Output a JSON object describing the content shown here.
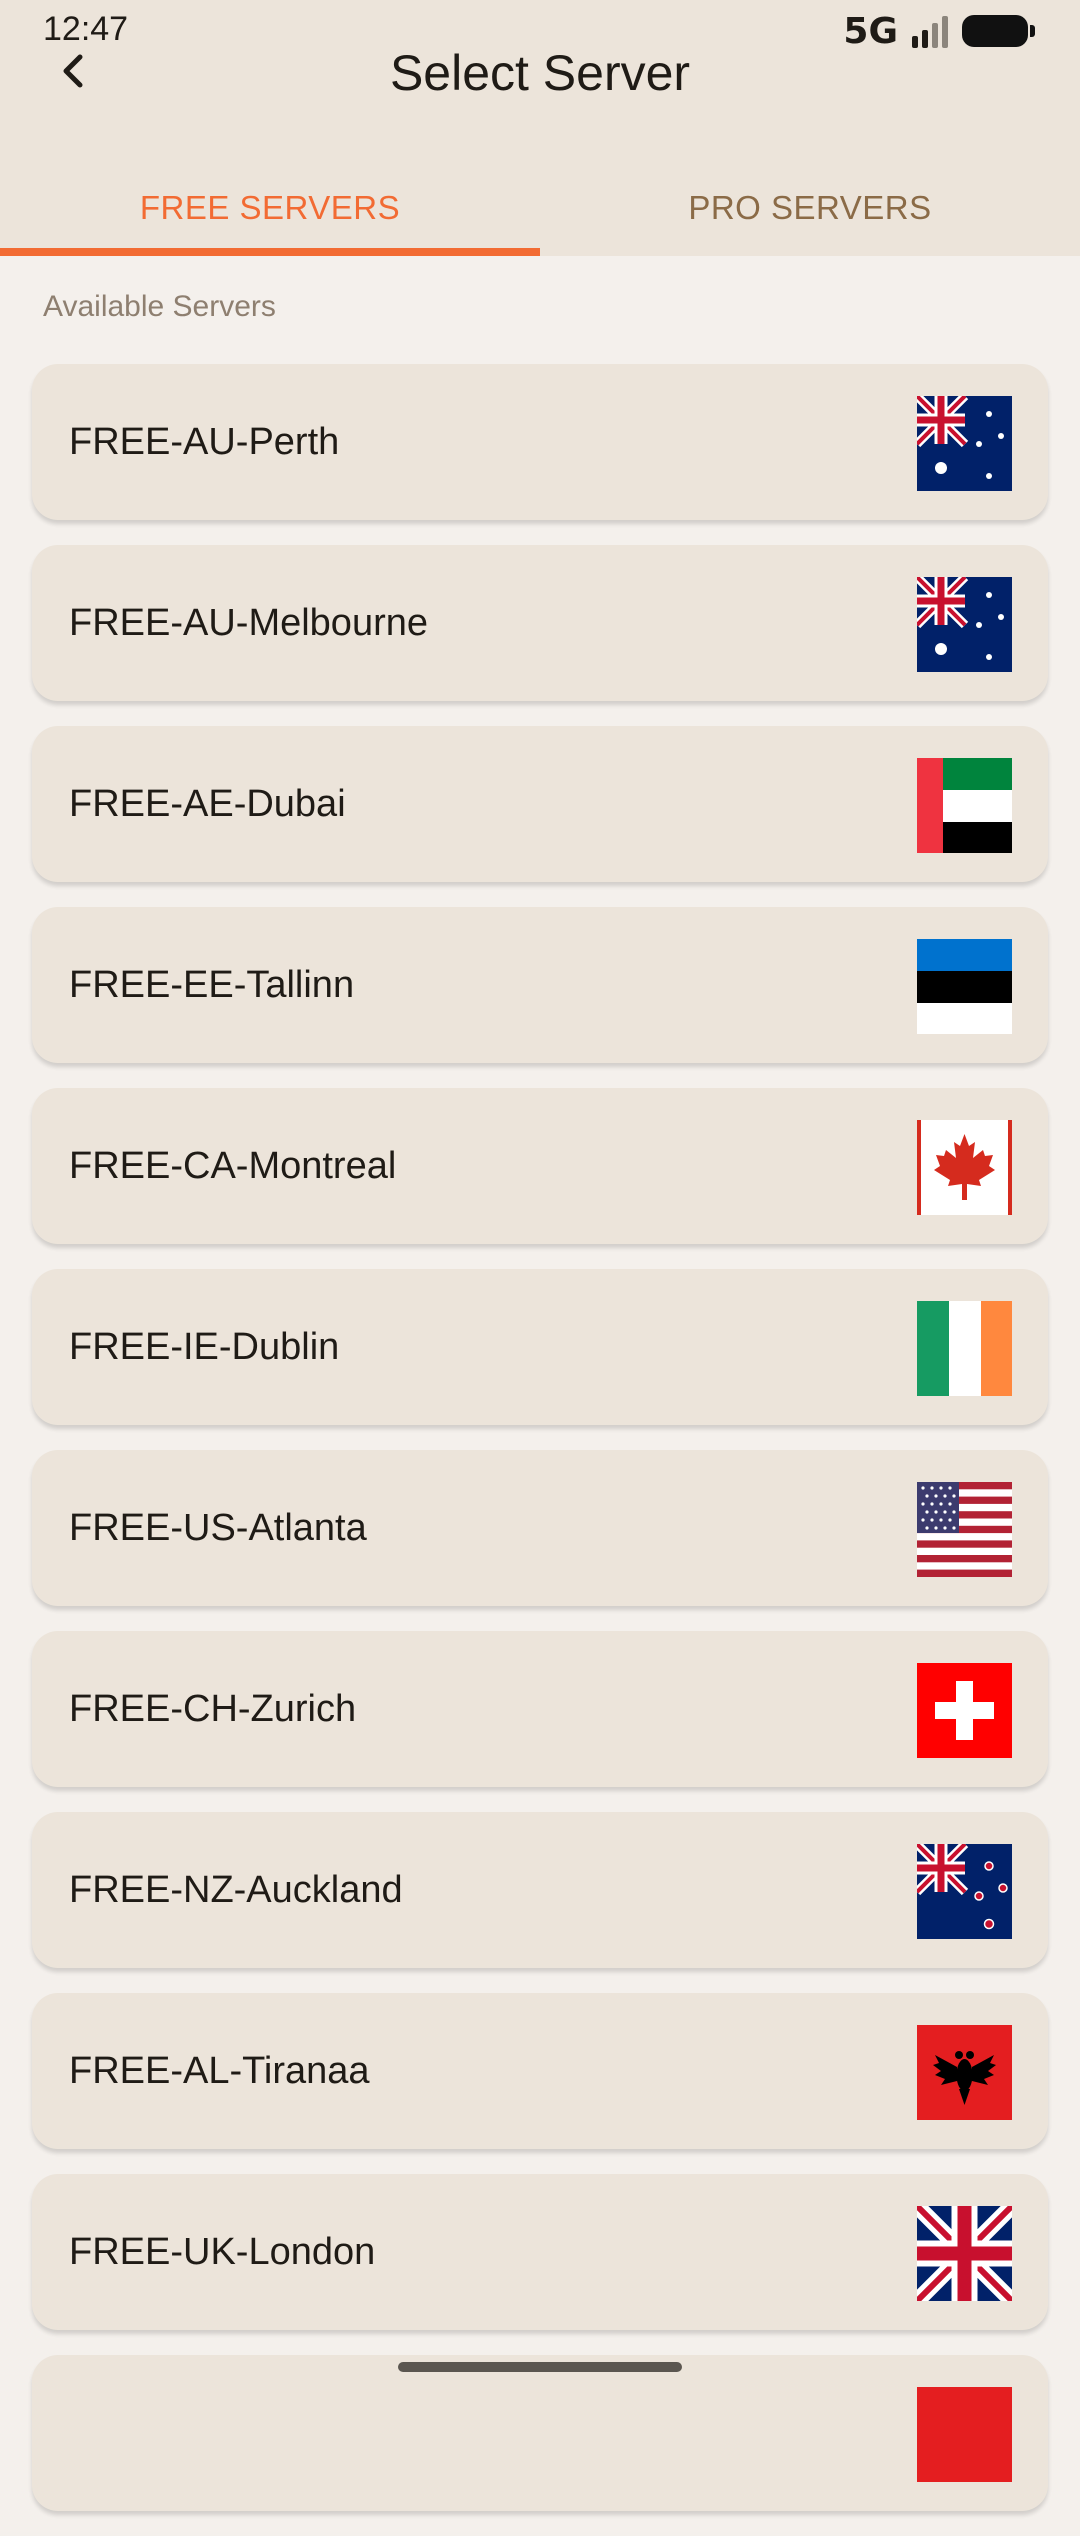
{
  "status_bar": {
    "time": "12:47",
    "network": "5G"
  },
  "header": {
    "title": "Select Server",
    "back_icon": "chevron-left-icon"
  },
  "tabs": [
    {
      "label": "FREE SERVERS",
      "active": true
    },
    {
      "label": "PRO SERVERS",
      "active": false
    }
  ],
  "colors": {
    "accent": "#f26b33",
    "inactive_tab": "#8b6b47",
    "card_bg": "#ece4da",
    "page_bg": "#f4f0ec"
  },
  "section": {
    "label": "Available Servers"
  },
  "servers": [
    {
      "name": "FREE-AU-Perth",
      "flag_icon": "australia-flag-icon"
    },
    {
      "name": "FREE-AU-Melbourne",
      "flag_icon": "australia-flag-icon"
    },
    {
      "name": "FREE-AE-Dubai",
      "flag_icon": "uae-flag-icon"
    },
    {
      "name": "FREE-EE-Tallinn",
      "flag_icon": "estonia-flag-icon"
    },
    {
      "name": "FREE-CA-Montreal",
      "flag_icon": "canada-flag-icon"
    },
    {
      "name": "FREE-IE-Dublin",
      "flag_icon": "ireland-flag-icon"
    },
    {
      "name": "FREE-US-Atlanta",
      "flag_icon": "usa-flag-icon"
    },
    {
      "name": "FREE-CH-Zurich",
      "flag_icon": "switzerland-flag-icon"
    },
    {
      "name": "FREE-NZ-Auckland",
      "flag_icon": "new-zealand-flag-icon"
    },
    {
      "name": "FREE-AL-Tiranaa",
      "flag_icon": "albania-flag-icon"
    },
    {
      "name": "FREE-UK-London",
      "flag_icon": "uk-flag-icon"
    },
    {
      "name": "",
      "flag_icon": "red-flag-icon"
    }
  ]
}
